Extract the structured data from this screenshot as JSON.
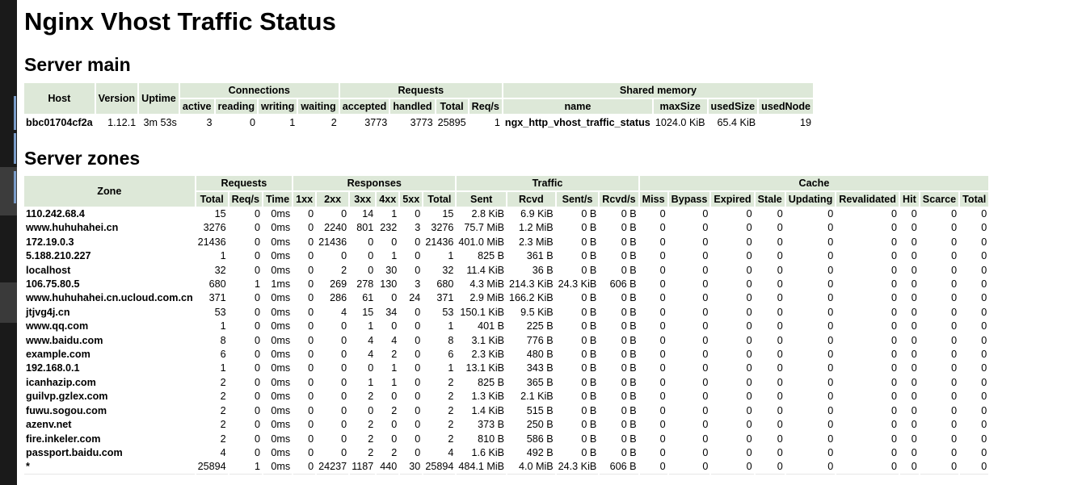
{
  "title": "Nginx Vhost Traffic Status",
  "server_main": {
    "heading": "Server main",
    "group_headers": [
      "Connections",
      "Requests",
      "Shared memory"
    ],
    "columns": [
      "Host",
      "Version",
      "Uptime",
      "active",
      "reading",
      "writing",
      "waiting",
      "accepted",
      "handled",
      "Total",
      "Req/s",
      "name",
      "maxSize",
      "usedSize",
      "usedNode"
    ],
    "row": [
      "bbc01704cf2a",
      "1.12.1",
      "3m 53s",
      "3",
      "0",
      "1",
      "2",
      "3773",
      "3773",
      "25895",
      "1",
      "ngx_http_vhost_traffic_status",
      "1024.0 KiB",
      "65.4 KiB",
      "19"
    ]
  },
  "server_zones": {
    "heading": "Server zones",
    "zone_header": "Zone",
    "group_headers": [
      "Requests",
      "Responses",
      "Traffic",
      "Cache"
    ],
    "columns": [
      "Total",
      "Req/s",
      "Time",
      "1xx",
      "2xx",
      "3xx",
      "4xx",
      "5xx",
      "Total",
      "Sent",
      "Rcvd",
      "Sent/s",
      "Rcvd/s",
      "Miss",
      "Bypass",
      "Expired",
      "Stale",
      "Updating",
      "Revalidated",
      "Hit",
      "Scarce",
      "Total"
    ],
    "rows": [
      [
        "110.242.68.4",
        "15",
        "0",
        "0ms",
        "0",
        "0",
        "14",
        "1",
        "0",
        "15",
        "2.8 KiB",
        "6.9 KiB",
        "0 B",
        "0 B",
        "0",
        "0",
        "0",
        "0",
        "0",
        "0",
        "0",
        "0",
        "0"
      ],
      [
        "www.huhuhahei.cn",
        "3276",
        "0",
        "0ms",
        "0",
        "2240",
        "801",
        "232",
        "3",
        "3276",
        "75.7 MiB",
        "1.2 MiB",
        "0 B",
        "0 B",
        "0",
        "0",
        "0",
        "0",
        "0",
        "0",
        "0",
        "0",
        "0"
      ],
      [
        "172.19.0.3",
        "21436",
        "0",
        "0ms",
        "0",
        "21436",
        "0",
        "0",
        "0",
        "21436",
        "401.0 MiB",
        "2.3 MiB",
        "0 B",
        "0 B",
        "0",
        "0",
        "0",
        "0",
        "0",
        "0",
        "0",
        "0",
        "0"
      ],
      [
        "5.188.210.227",
        "1",
        "0",
        "0ms",
        "0",
        "0",
        "0",
        "1",
        "0",
        "1",
        "825 B",
        "361 B",
        "0 B",
        "0 B",
        "0",
        "0",
        "0",
        "0",
        "0",
        "0",
        "0",
        "0",
        "0"
      ],
      [
        "localhost",
        "32",
        "0",
        "0ms",
        "0",
        "2",
        "0",
        "30",
        "0",
        "32",
        "11.4 KiB",
        "36 B",
        "0 B",
        "0 B",
        "0",
        "0",
        "0",
        "0",
        "0",
        "0",
        "0",
        "0",
        "0"
      ],
      [
        "106.75.80.5",
        "680",
        "1",
        "1ms",
        "0",
        "269",
        "278",
        "130",
        "3",
        "680",
        "4.3 MiB",
        "214.3 KiB",
        "24.3 KiB",
        "606 B",
        "0",
        "0",
        "0",
        "0",
        "0",
        "0",
        "0",
        "0",
        "0"
      ],
      [
        "www.huhuhahei.cn.ucloud.com.cn",
        "371",
        "0",
        "0ms",
        "0",
        "286",
        "61",
        "0",
        "24",
        "371",
        "2.9 MiB",
        "166.2 KiB",
        "0 B",
        "0 B",
        "0",
        "0",
        "0",
        "0",
        "0",
        "0",
        "0",
        "0",
        "0"
      ],
      [
        "jtjvg4j.cn",
        "53",
        "0",
        "0ms",
        "0",
        "4",
        "15",
        "34",
        "0",
        "53",
        "150.1 KiB",
        "9.5 KiB",
        "0 B",
        "0 B",
        "0",
        "0",
        "0",
        "0",
        "0",
        "0",
        "0",
        "0",
        "0"
      ],
      [
        "www.qq.com",
        "1",
        "0",
        "0ms",
        "0",
        "0",
        "1",
        "0",
        "0",
        "1",
        "401 B",
        "225 B",
        "0 B",
        "0 B",
        "0",
        "0",
        "0",
        "0",
        "0",
        "0",
        "0",
        "0",
        "0"
      ],
      [
        "www.baidu.com",
        "8",
        "0",
        "0ms",
        "0",
        "0",
        "4",
        "4",
        "0",
        "8",
        "3.1 KiB",
        "776 B",
        "0 B",
        "0 B",
        "0",
        "0",
        "0",
        "0",
        "0",
        "0",
        "0",
        "0",
        "0"
      ],
      [
        "example.com",
        "6",
        "0",
        "0ms",
        "0",
        "0",
        "4",
        "2",
        "0",
        "6",
        "2.3 KiB",
        "480 B",
        "0 B",
        "0 B",
        "0",
        "0",
        "0",
        "0",
        "0",
        "0",
        "0",
        "0",
        "0"
      ],
      [
        "192.168.0.1",
        "1",
        "0",
        "0ms",
        "0",
        "0",
        "0",
        "1",
        "0",
        "1",
        "13.1 KiB",
        "343 B",
        "0 B",
        "0 B",
        "0",
        "0",
        "0",
        "0",
        "0",
        "0",
        "0",
        "0",
        "0"
      ],
      [
        "icanhazip.com",
        "2",
        "0",
        "0ms",
        "0",
        "0",
        "1",
        "1",
        "0",
        "2",
        "825 B",
        "365 B",
        "0 B",
        "0 B",
        "0",
        "0",
        "0",
        "0",
        "0",
        "0",
        "0",
        "0",
        "0"
      ],
      [
        "guilvp.gzlex.com",
        "2",
        "0",
        "0ms",
        "0",
        "0",
        "2",
        "0",
        "0",
        "2",
        "1.3 KiB",
        "2.1 KiB",
        "0 B",
        "0 B",
        "0",
        "0",
        "0",
        "0",
        "0",
        "0",
        "0",
        "0",
        "0"
      ],
      [
        "fuwu.sogou.com",
        "2",
        "0",
        "0ms",
        "0",
        "0",
        "0",
        "2",
        "0",
        "2",
        "1.4 KiB",
        "515 B",
        "0 B",
        "0 B",
        "0",
        "0",
        "0",
        "0",
        "0",
        "0",
        "0",
        "0",
        "0"
      ],
      [
        "azenv.net",
        "2",
        "0",
        "0ms",
        "0",
        "0",
        "2",
        "0",
        "0",
        "2",
        "373 B",
        "250 B",
        "0 B",
        "0 B",
        "0",
        "0",
        "0",
        "0",
        "0",
        "0",
        "0",
        "0",
        "0"
      ],
      [
        "fire.inkeler.com",
        "2",
        "0",
        "0ms",
        "0",
        "0",
        "2",
        "0",
        "0",
        "2",
        "810 B",
        "586 B",
        "0 B",
        "0 B",
        "0",
        "0",
        "0",
        "0",
        "0",
        "0",
        "0",
        "0",
        "0"
      ],
      [
        "passport.baidu.com",
        "4",
        "0",
        "0ms",
        "0",
        "0",
        "2",
        "2",
        "0",
        "4",
        "1.6 KiB",
        "492 B",
        "0 B",
        "0 B",
        "0",
        "0",
        "0",
        "0",
        "0",
        "0",
        "0",
        "0",
        "0"
      ],
      [
        "*",
        "25894",
        "1",
        "0ms",
        "0",
        "24237",
        "1187",
        "440",
        "30",
        "25894",
        "484.1 MiB",
        "4.0 MiB",
        "24.3 KiB",
        "606 B",
        "0",
        "0",
        "0",
        "0",
        "0",
        "0",
        "0",
        "0",
        "0"
      ]
    ]
  }
}
